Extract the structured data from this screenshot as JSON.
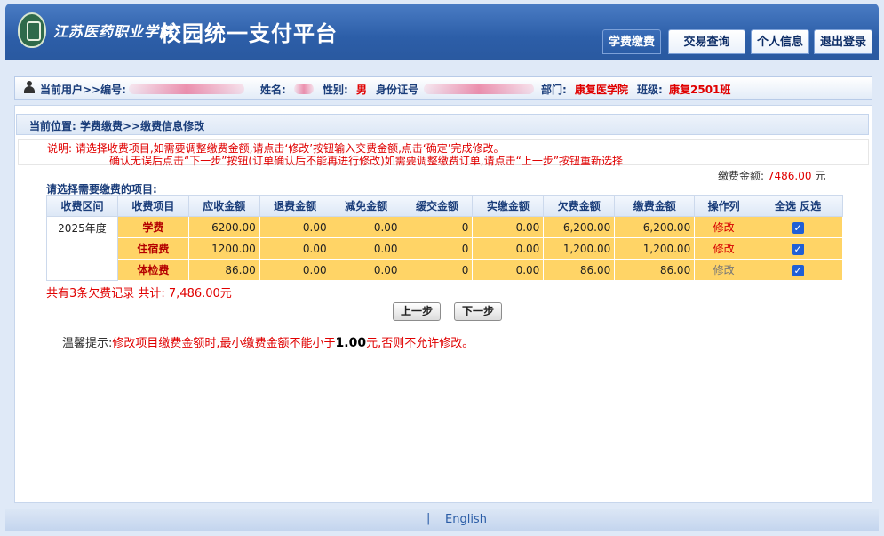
{
  "header": {
    "school_name": "江苏医药职业学院",
    "platform_title": "校园统一支付平台",
    "nav": [
      {
        "label": "学费缴费",
        "active": true
      },
      {
        "label": "交易查询",
        "active": false
      },
      {
        "label": "个人信息",
        "active": false
      },
      {
        "label": "退出登录",
        "active": false
      }
    ]
  },
  "user_bar": {
    "current_user": "当前用户>>编号:",
    "name_label": "姓名:",
    "gender_label": "性别:",
    "gender": "男",
    "id_label": "身份证号",
    "dept_label": "部门:",
    "dept": "康复医学院",
    "class_label": "班级:",
    "class": "康复2501班"
  },
  "breadcrumb": "当前位置: 学费缴费>>缴费信息修改",
  "notice": {
    "line1": "说明: 请选择收费项目,如需要调整缴费金额,请点击‘修改’按钮输入交费金额,点击‘确定’完成修改。",
    "line2": "确认无误后点击“下一步”按钮(订单确认后不能再进行修改)如需要调整缴费订单,请点击“上一步”按钮重新选择"
  },
  "pay_amount": {
    "label": "缴费金额:",
    "value": "7486.00",
    "unit": "元"
  },
  "select_prompt": "请选择需要缴费的项目:",
  "table": {
    "headers": [
      "收费区间",
      "收费项目",
      "应收金额",
      "退费金额",
      "减免金额",
      "缓交金额",
      "实缴金额",
      "欠费金额",
      "缴费金额",
      "操作列",
      "全选 反选"
    ],
    "period": "2025年度",
    "rows": [
      {
        "item": "学费",
        "receivable": "6200.00",
        "refund": "0.00",
        "waiver": "0.00",
        "deferred": "0",
        "paid": "0.00",
        "owed": "6,200.00",
        "pay": "6,200.00",
        "op": "修改"
      },
      {
        "item": "住宿费",
        "receivable": "1200.00",
        "refund": "0.00",
        "waiver": "0.00",
        "deferred": "0",
        "paid": "0.00",
        "owed": "1,200.00",
        "pay": "1,200.00",
        "op": "修改"
      },
      {
        "item": "体检费",
        "receivable": "86.00",
        "refund": "0.00",
        "waiver": "0.00",
        "deferred": "0",
        "paid": "0.00",
        "owed": "86.00",
        "pay": "86.00",
        "op": "修改"
      }
    ]
  },
  "summary": "共有3条欠费记录 共计: 7,486.00元",
  "buttons": {
    "prev": "上一步",
    "next": "下一步"
  },
  "tip": {
    "label": "温馨提示:",
    "text1": "修改项目缴费金额时,最小缴费金额不能小于",
    "min": "1.00",
    "text2": "元,否则不允许修改。"
  },
  "footer": {
    "separator": "|",
    "language": "English"
  }
}
